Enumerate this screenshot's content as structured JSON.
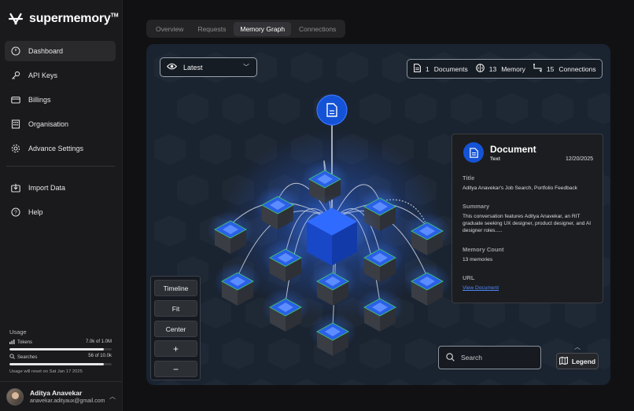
{
  "app": {
    "name": "supermemory",
    "tm": "TM"
  },
  "sidebar": {
    "items": [
      {
        "label": "Dashboard",
        "icon": "dashboard-icon"
      },
      {
        "label": "API Keys",
        "icon": "key-icon"
      },
      {
        "label": "Billings",
        "icon": "card-icon"
      },
      {
        "label": "Organisation",
        "icon": "building-icon"
      },
      {
        "label": "Advance Settings",
        "icon": "gear-icon"
      }
    ],
    "secondary": [
      {
        "label": "Import Data",
        "icon": "import-icon"
      },
      {
        "label": "Help",
        "icon": "help-icon"
      }
    ],
    "usage": {
      "title": "Usage",
      "tokens_label": "Tokens",
      "tokens_value": "7.0k of 1.0M",
      "tokens_fraction": 0.007,
      "searches_label": "Searches",
      "searches_value": "56 of 10.0k",
      "searches_fraction": 0.0056,
      "reset_note": "Usage will reset on Sat Jan 17 2025"
    },
    "user": {
      "name": "Aditya Anavekar",
      "email": "anavekar.adityaux@gmail.com"
    }
  },
  "tabs": [
    "Overview",
    "Requests",
    "Memory Graph",
    "Connections"
  ],
  "active_tab": "Memory Graph",
  "graph": {
    "filter": "Latest",
    "stats": {
      "documents": "1",
      "documents_label": "Documents",
      "memory": "13",
      "memory_label": "Memory",
      "connections": "15",
      "connections_label": "Connections"
    },
    "controls": [
      "Timeline",
      "Fit",
      "Center",
      "+",
      "−"
    ],
    "search_placeholder": "Search",
    "legend_label": "Legend"
  },
  "document_card": {
    "title": "Document",
    "type": "Text",
    "date": "12/20/2025",
    "title_label": "Title",
    "title_value": "Aditya Anavekar's Job Search, Portfolio Feedback",
    "summary_label": "Summary",
    "summary_value": "This conversation features Aditya Anavekar, an RIT graduate seeking UX designer, product designer, and AI designer roles.....",
    "memory_count_label": "Memory Count",
    "memory_count_value": "13 memories",
    "url_label": "URL",
    "url_value": "View Document"
  },
  "colors": {
    "accent": "#1553d6",
    "node_glow": "#2f6bff",
    "node_edge": "#3ec46d"
  }
}
